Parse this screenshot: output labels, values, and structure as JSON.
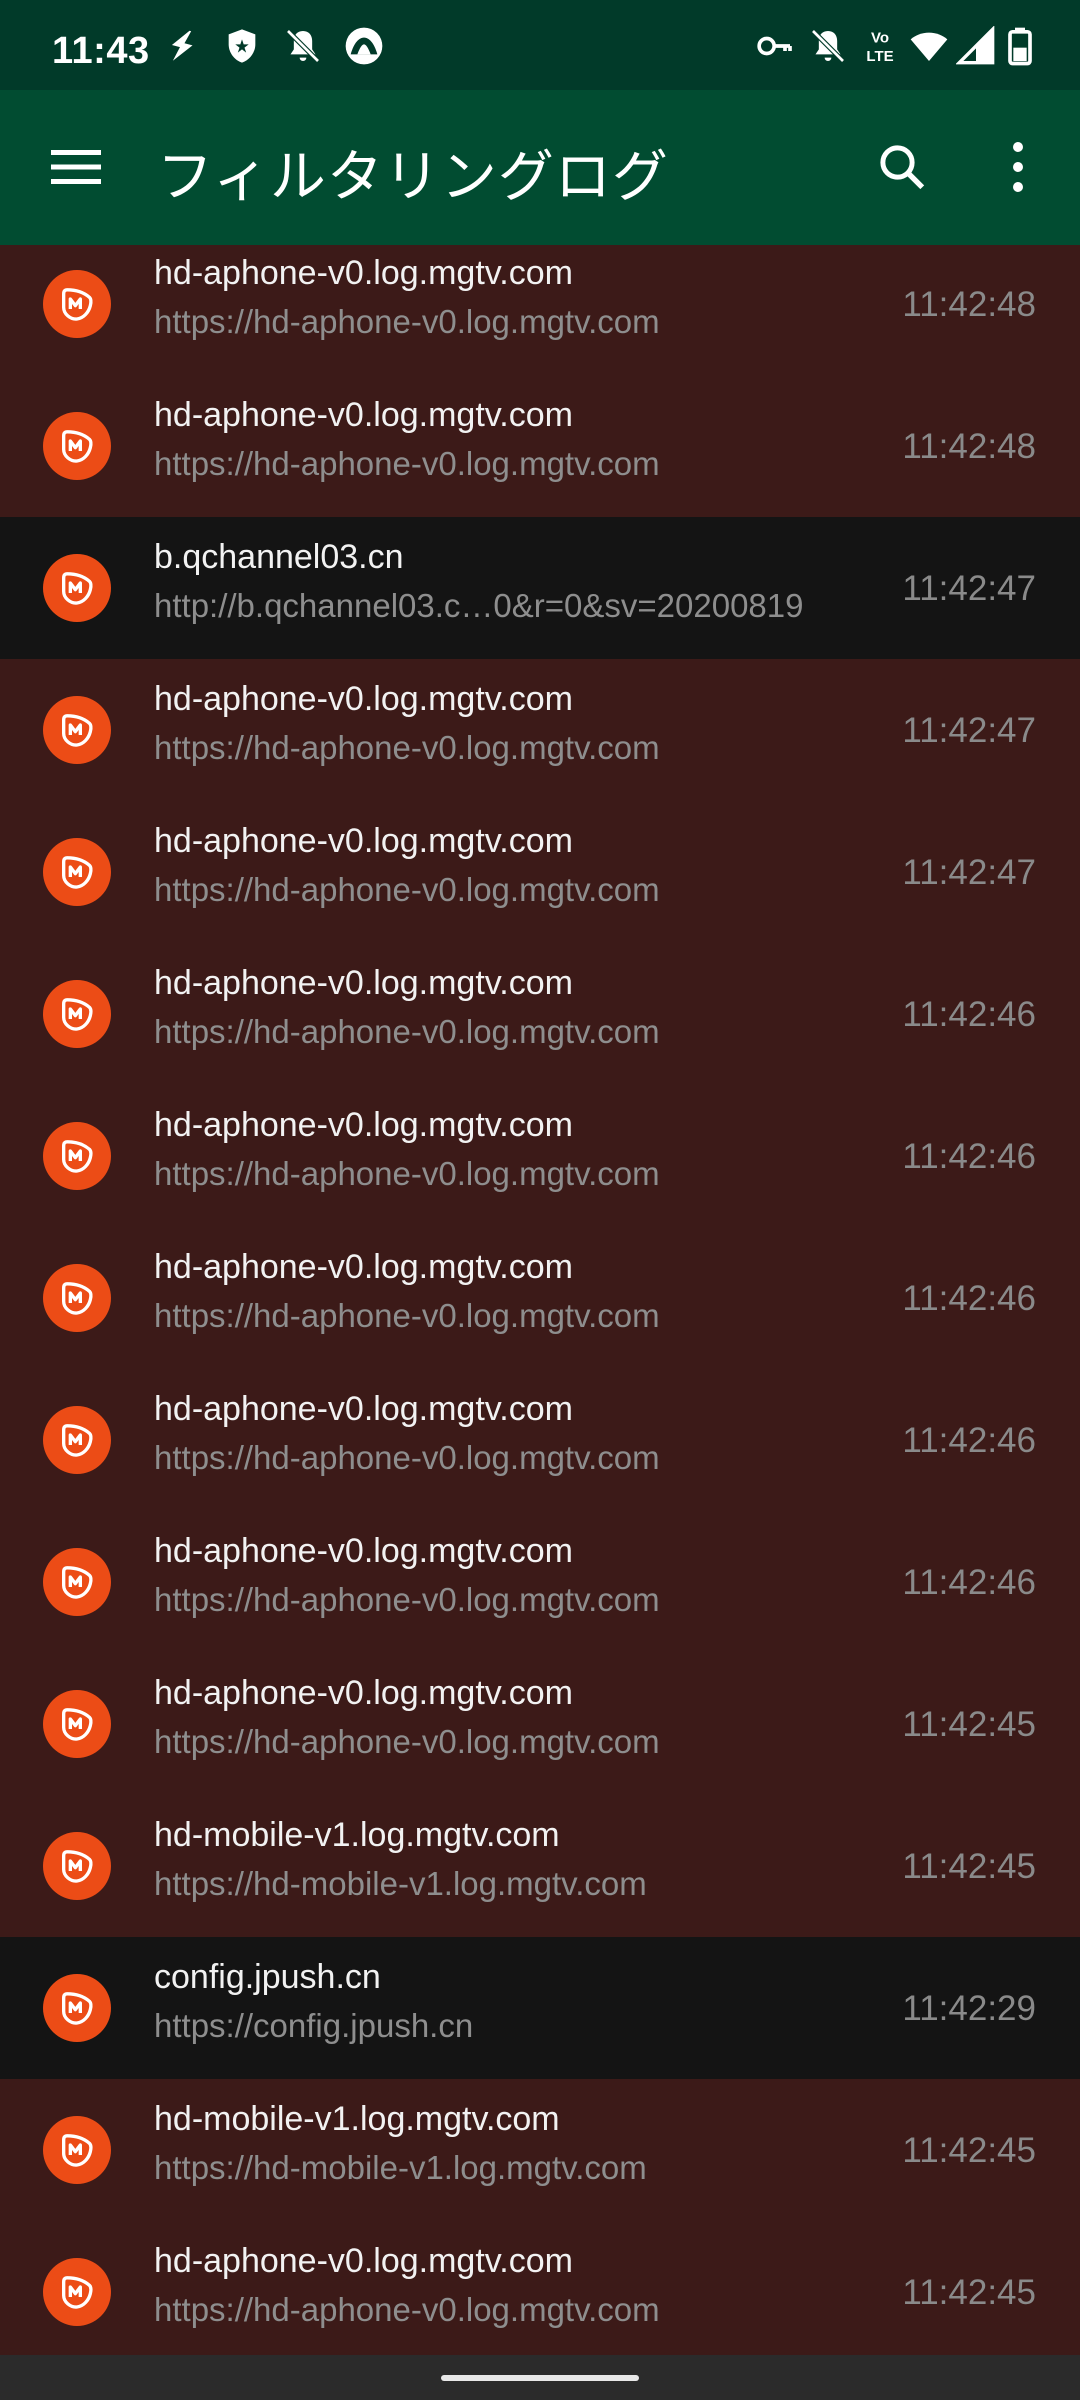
{
  "status_bar": {
    "time": "11:43",
    "left_icons": [
      "flash-icon",
      "shield-icon",
      "bell-off-icon",
      "app-status-icon"
    ],
    "right_icons": [
      "key-icon",
      "bell-off-icon",
      "volte-icon",
      "wifi-icon",
      "signal-icon",
      "battery-icon"
    ]
  },
  "app_bar": {
    "title": "フィルタリングログ",
    "menu_icon": "hamburger-menu-icon",
    "search_icon": "search-icon",
    "more_icon": "more-vert-icon"
  },
  "colors": {
    "status_bar_bg": "#013a29",
    "app_bar_bg": "#014c31",
    "blocked_row_bg": "#3c1a18",
    "allowed_row_bg": "#141414",
    "app_icon_bg": "#ec4c16"
  },
  "log_entries": [
    {
      "domain": "hd-aphone-v0.log.mgtv.com",
      "url": "https://hd-aphone-v0.log.mgtv.com",
      "time": "11:42:48",
      "status": "blocked"
    },
    {
      "domain": "hd-aphone-v0.log.mgtv.com",
      "url": "https://hd-aphone-v0.log.mgtv.com",
      "time": "11:42:48",
      "status": "blocked"
    },
    {
      "domain": "b.qchannel03.cn",
      "url": "http://b.qchannel03.c…0&r=0&sv=20200819",
      "time": "11:42:47",
      "status": "allowed"
    },
    {
      "domain": "hd-aphone-v0.log.mgtv.com",
      "url": "https://hd-aphone-v0.log.mgtv.com",
      "time": "11:42:47",
      "status": "blocked"
    },
    {
      "domain": "hd-aphone-v0.log.mgtv.com",
      "url": "https://hd-aphone-v0.log.mgtv.com",
      "time": "11:42:47",
      "status": "blocked"
    },
    {
      "domain": "hd-aphone-v0.log.mgtv.com",
      "url": "https://hd-aphone-v0.log.mgtv.com",
      "time": "11:42:46",
      "status": "blocked"
    },
    {
      "domain": "hd-aphone-v0.log.mgtv.com",
      "url": "https://hd-aphone-v0.log.mgtv.com",
      "time": "11:42:46",
      "status": "blocked"
    },
    {
      "domain": "hd-aphone-v0.log.mgtv.com",
      "url": "https://hd-aphone-v0.log.mgtv.com",
      "time": "11:42:46",
      "status": "blocked"
    },
    {
      "domain": "hd-aphone-v0.log.mgtv.com",
      "url": "https://hd-aphone-v0.log.mgtv.com",
      "time": "11:42:46",
      "status": "blocked"
    },
    {
      "domain": "hd-aphone-v0.log.mgtv.com",
      "url": "https://hd-aphone-v0.log.mgtv.com",
      "time": "11:42:46",
      "status": "blocked"
    },
    {
      "domain": "hd-aphone-v0.log.mgtv.com",
      "url": "https://hd-aphone-v0.log.mgtv.com",
      "time": "11:42:45",
      "status": "blocked"
    },
    {
      "domain": "hd-mobile-v1.log.mgtv.com",
      "url": "https://hd-mobile-v1.log.mgtv.com",
      "time": "11:42:45",
      "status": "blocked"
    },
    {
      "domain": "config.jpush.cn",
      "url": "https://config.jpush.cn",
      "time": "11:42:29",
      "status": "allowed"
    },
    {
      "domain": "hd-mobile-v1.log.mgtv.com",
      "url": "https://hd-mobile-v1.log.mgtv.com",
      "time": "11:42:45",
      "status": "blocked"
    },
    {
      "domain": "hd-aphone-v0.log.mgtv.com",
      "url": "https://hd-aphone-v0.log.mgtv.com",
      "time": "11:42:45",
      "status": "blocked"
    }
  ]
}
